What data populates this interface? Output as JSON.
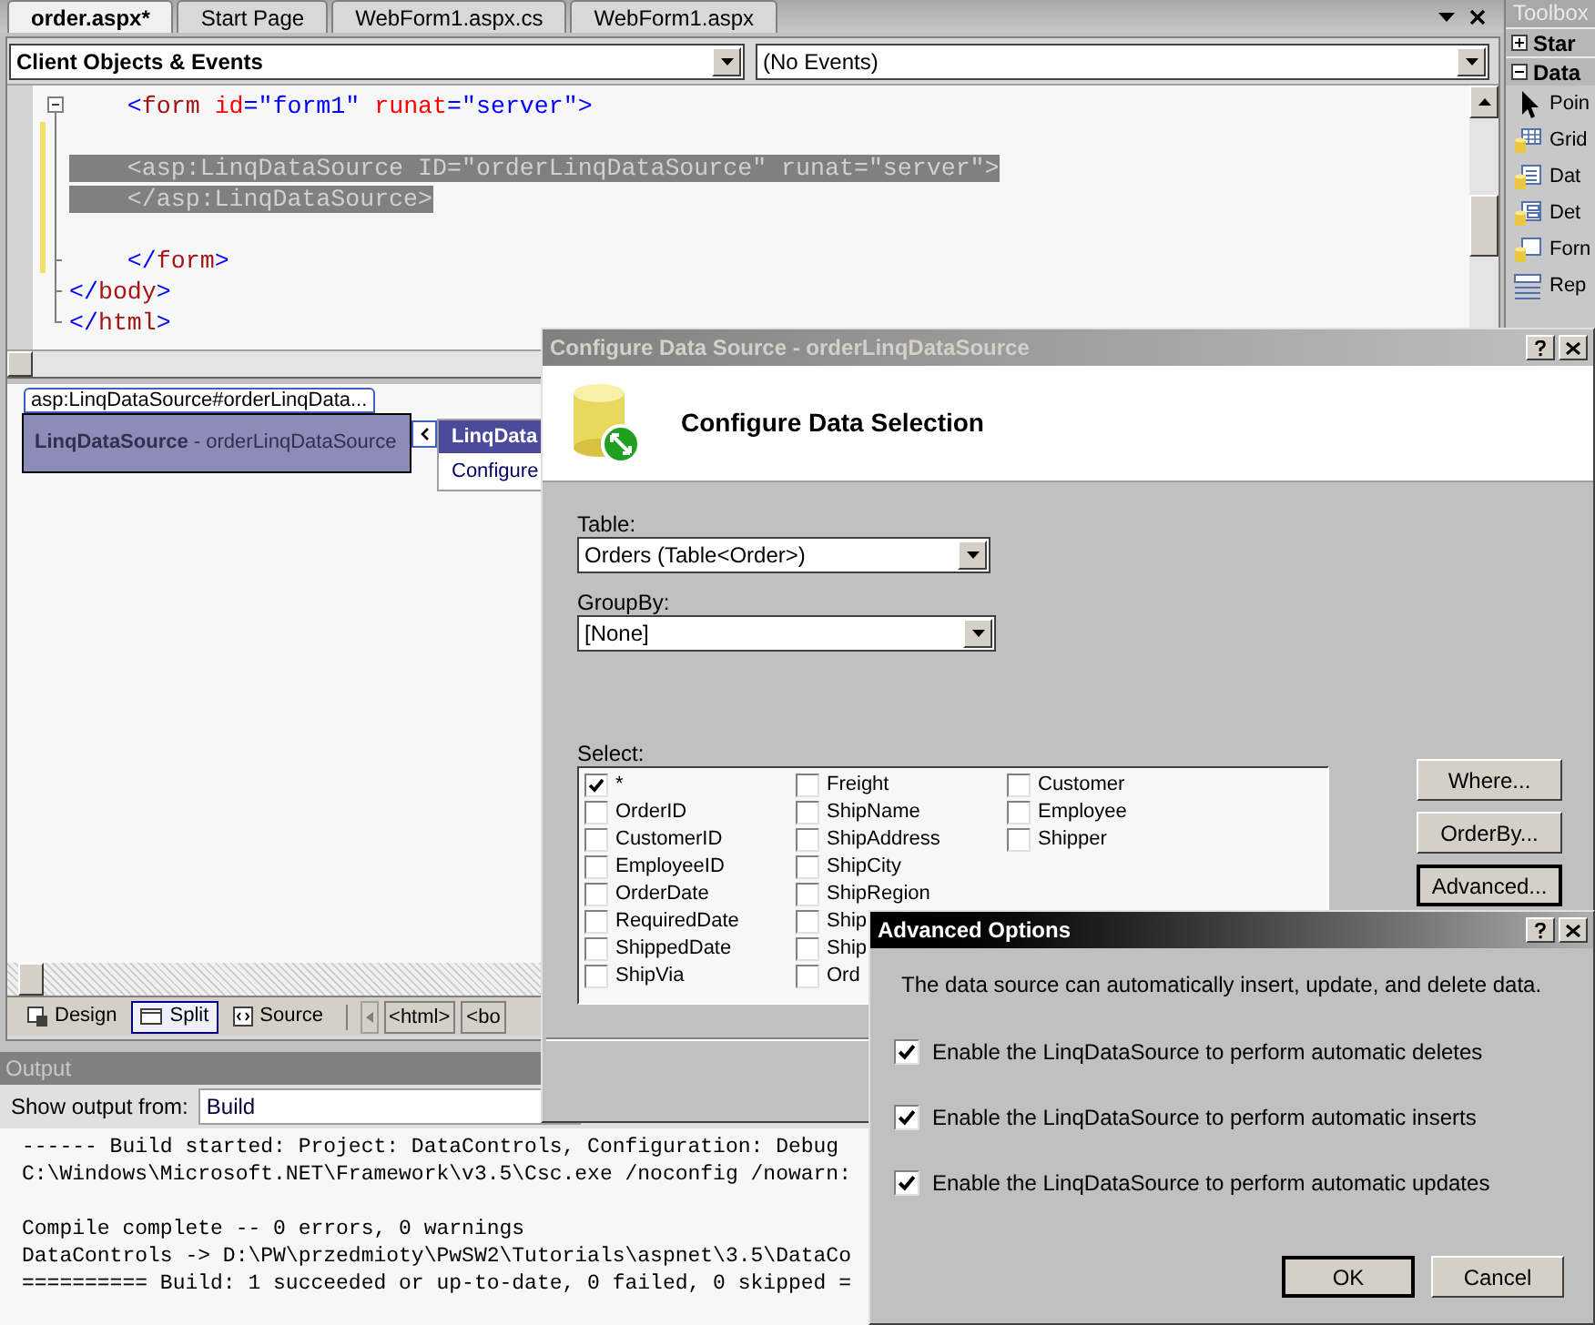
{
  "editor_tabs": [
    {
      "label": "order.aspx*",
      "selected": true
    },
    {
      "label": "Start Page",
      "selected": false
    },
    {
      "label": "WebForm1.aspx.cs",
      "selected": false
    },
    {
      "label": "WebForm1.aspx",
      "selected": false
    }
  ],
  "code_editor": {
    "object_combo": "Client Objects & Events",
    "event_combo": "(No Events)",
    "blocks": [
      [
        {
          "text": "    <form id=\"form1\" runat=\"server\">",
          "selected": false
        }
      ],
      [
        {
          "text": "    <asp:LinqDataSource ID=\"orderLinqDataSource\" runat=\"server\">",
          "selected": true
        },
        {
          "text": "    </asp:LinqDataSource>",
          "selected": true
        }
      ],
      [
        {
          "text": "    </form>",
          "selected": false
        },
        {
          "text": "</body>",
          "selected": false
        },
        {
          "text": "</html>",
          "selected": false
        }
      ]
    ]
  },
  "design_view": {
    "tag_label": "asp:LinqDataSource#orderLinqData...",
    "control": "**LinqDataSource** - orderLinqDataSource",
    "smart_tag_menu": {
      "header": "LinqData",
      "items": [
        "Configure"
      ]
    }
  },
  "view_tabs": [
    {
      "label": "Design",
      "kind": "design",
      "selected": false
    },
    {
      "label": "Split",
      "kind": "split",
      "selected": true
    },
    {
      "label": "Source",
      "kind": "source",
      "selected": false
    }
  ],
  "breadcrumbs": [
    "<html>",
    "<bo"
  ],
  "output": {
    "title": "Output",
    "source_label": "Show output from:",
    "source_value": "Build",
    "blocks": [
      [
        "------ Build started: Project: DataControls, Configuration: Debug",
        "C:\\Windows\\Microsoft.NET\\Framework\\v3.5\\Csc.exe /noconfig /nowarn:"
      ],
      [
        "Compile complete -- 0 errors, 0 warnings",
        "DataControls -> D:\\PW\\przedmioty\\PwSW2\\Tutorials\\aspnet\\3.5\\DataCo",
        "========== Build: 1 succeeded or up-to-date, 0 failed, 0 skipped ="
      ]
    ]
  },
  "toolbox": {
    "title": "Toolbox",
    "groups": [
      {
        "label": "Star",
        "expanded": false
      },
      {
        "label": "Data",
        "expanded": true,
        "items": [
          {
            "label": "Poin",
            "kind": "pointer"
          },
          {
            "label": "Grid",
            "kind": "grid"
          },
          {
            "label": "Dat",
            "kind": "list"
          },
          {
            "label": "Det",
            "kind": "details"
          },
          {
            "label": "Forn",
            "kind": "form"
          },
          {
            "label": "Rep",
            "kind": "repeater"
          }
        ]
      }
    ]
  },
  "configure_dialog": {
    "title": "Configure Data Source - orderLinqDataSource",
    "active": false,
    "heading": "Configure Data Selection",
    "table_label": "Table:",
    "table_value": "Orders (Table<Order>)",
    "groupby_label": "GroupBy:",
    "groupby_value": "[None]",
    "select_label": "Select:",
    "columns": [
      [
        {
          "label": "*",
          "checked": true
        },
        {
          "label": "OrderID",
          "checked": false
        },
        {
          "label": "CustomerID",
          "checked": false
        },
        {
          "label": "EmployeeID",
          "checked": false
        },
        {
          "label": "OrderDate",
          "checked": false
        },
        {
          "label": "RequiredDate",
          "checked": false
        },
        {
          "label": "ShippedDate",
          "checked": false
        },
        {
          "label": "ShipVia",
          "checked": false
        }
      ],
      [
        {
          "label": "Freight",
          "checked": false
        },
        {
          "label": "ShipName",
          "checked": false
        },
        {
          "label": "ShipAddress",
          "checked": false
        },
        {
          "label": "ShipCity",
          "checked": false
        },
        {
          "label": "ShipRegion",
          "checked": false
        },
        {
          "label": "Ship",
          "checked": false
        },
        {
          "label": "Ship",
          "checked": false
        },
        {
          "label": "Ord",
          "checked": false
        }
      ],
      [
        {
          "label": "Customer",
          "checked": false
        },
        {
          "label": "Employee",
          "checked": false
        },
        {
          "label": "Shipper",
          "checked": false
        }
      ]
    ],
    "buttons": [
      {
        "label": "Where...",
        "default": false
      },
      {
        "label": "OrderBy...",
        "default": false
      },
      {
        "label": "Advanced...",
        "default": true
      }
    ]
  },
  "advanced_dialog": {
    "title": "Advanced Options",
    "active": true,
    "description": "The data source can automatically insert, update, and delete data.",
    "options": [
      {
        "label": "Enable the LinqDataSource to perform automatic deletes",
        "checked": true
      },
      {
        "label": "Enable the LinqDataSource to perform automatic inserts",
        "checked": true
      },
      {
        "label": "Enable the LinqDataSource to perform automatic updates",
        "checked": true
      }
    ],
    "buttons": [
      {
        "label": "OK",
        "default": true
      },
      {
        "label": "Cancel",
        "default": false
      }
    ]
  }
}
